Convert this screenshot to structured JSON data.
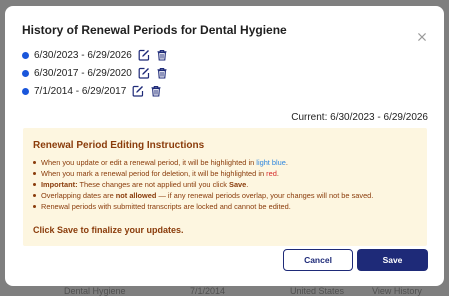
{
  "backdrop": {
    "fragments": [
      "Dental Hygiene",
      "7/1/2014",
      "United States",
      "View History"
    ]
  },
  "modal": {
    "title": "History of Renewal Periods for Dental Hygiene",
    "close_icon": "close-icon"
  },
  "periods": [
    {
      "range": "6/30/2023 - 6/29/2026",
      "edit_icon": "edit-icon",
      "delete_icon": "trash-icon"
    },
    {
      "range": "6/30/2017 - 6/29/2020",
      "edit_icon": "edit-icon",
      "delete_icon": "trash-icon"
    },
    {
      "range": "7/1/2014 - 6/29/2017",
      "edit_icon": "edit-icon",
      "delete_icon": "trash-icon"
    }
  ],
  "current": {
    "text": "Current: 6/30/2023 - 6/29/2026"
  },
  "instructions": {
    "title": "Renewal Period Editing Instructions",
    "items": [
      {
        "pre": "When you update or edit a renewal period, it will be highlighted in ",
        "highlight": "light blue",
        "post": "."
      },
      {
        "pre": "When you mark a renewal period for deletion, it will be highlighted in ",
        "highlight": "red",
        "post": "."
      },
      {
        "bold": "Important:",
        "pre": " These changes are not applied until you click ",
        "bold2": "Save",
        "post": "."
      },
      {
        "pre": "Overlapping dates are ",
        "bold": "not allowed",
        "post": " — if any renewal periods overlap, your changes will not be saved."
      },
      {
        "pre": "Renewal periods with submitted transcripts are locked and cannot be edited."
      }
    ],
    "footer": "Click Save to finalize your updates."
  },
  "buttons": {
    "cancel": "Cancel",
    "save": "Save"
  },
  "colors": {
    "accent": "#1e2a78",
    "dot": "#1a56db",
    "instruction_text": "#8a3c0b",
    "instruction_bg": "#fdf6e0",
    "highlight_blue": "#2e86de",
    "highlight_red": "#d62828"
  }
}
